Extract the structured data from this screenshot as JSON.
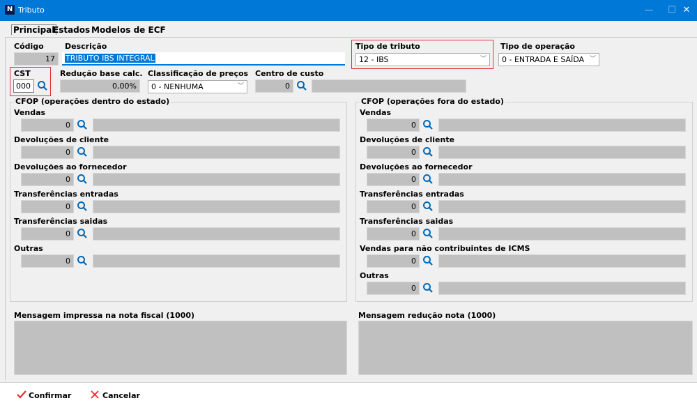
{
  "window": {
    "title": "Tributo",
    "minimize": "—",
    "maximize": "☐",
    "close": "✕"
  },
  "tabs": [
    "Principal",
    "Estados",
    "Modelos de ECF"
  ],
  "top": {
    "codigo_label": "Código",
    "codigo_value": "17",
    "descricao_label": "Descrição",
    "descricao_value": "TRIBUTO IBS INTEGRAL",
    "tipo_tributo_label": "Tipo de tributo",
    "tipo_tributo_value": "12 - IBS",
    "tipo_operacao_label": "Tipo de operação",
    "tipo_operacao_value": "0 - ENTRADA E SAÍDA",
    "cst_label": "CST",
    "cst_value": "000",
    "reducao_label": "Redução base calc.",
    "reducao_value": "0,00%",
    "classificacao_label": "Classificação de preços",
    "classificacao_value": "0 - NENHUMA",
    "centro_label": "Centro de custo",
    "centro_value": "0"
  },
  "cfop_dentro": {
    "title": "CFOP (operações dentro do estado)",
    "rows": [
      {
        "label": "Vendas",
        "value": "0"
      },
      {
        "label": "Devoluções de cliente",
        "value": "0"
      },
      {
        "label": "Devoluções ao fornecedor",
        "value": "0"
      },
      {
        "label": "Transferências entradas",
        "value": "0"
      },
      {
        "label": "Transferências saidas",
        "value": "0"
      },
      {
        "label": "Outras",
        "value": "0"
      }
    ]
  },
  "cfop_fora": {
    "title": "CFOP (operações fora do estado)",
    "rows": [
      {
        "label": "Vendas",
        "value": "0"
      },
      {
        "label": "Devoluções de cliente",
        "value": "0"
      },
      {
        "label": "Devoluções ao fornecedor",
        "value": "0"
      },
      {
        "label": "Transferências entradas",
        "value": "0"
      },
      {
        "label": "Transferências saidas",
        "value": "0"
      },
      {
        "label": "Vendas para não contribuintes de ICMS",
        "value": "0"
      },
      {
        "label": "Outras",
        "value": "0"
      }
    ]
  },
  "mensagem_nota": "Mensagem impressa na nota fiscal (1000)",
  "mensagem_reducao": "Mensagem redução nota (1000)",
  "buttons": {
    "confirmar": "Confirmar",
    "cancelar": "Cancelar"
  },
  "colors": {
    "accent": "#0078d7",
    "highlight_border": "#e0303a",
    "confirm_icon": "#e03030",
    "cancel_icon": "#e03030"
  }
}
